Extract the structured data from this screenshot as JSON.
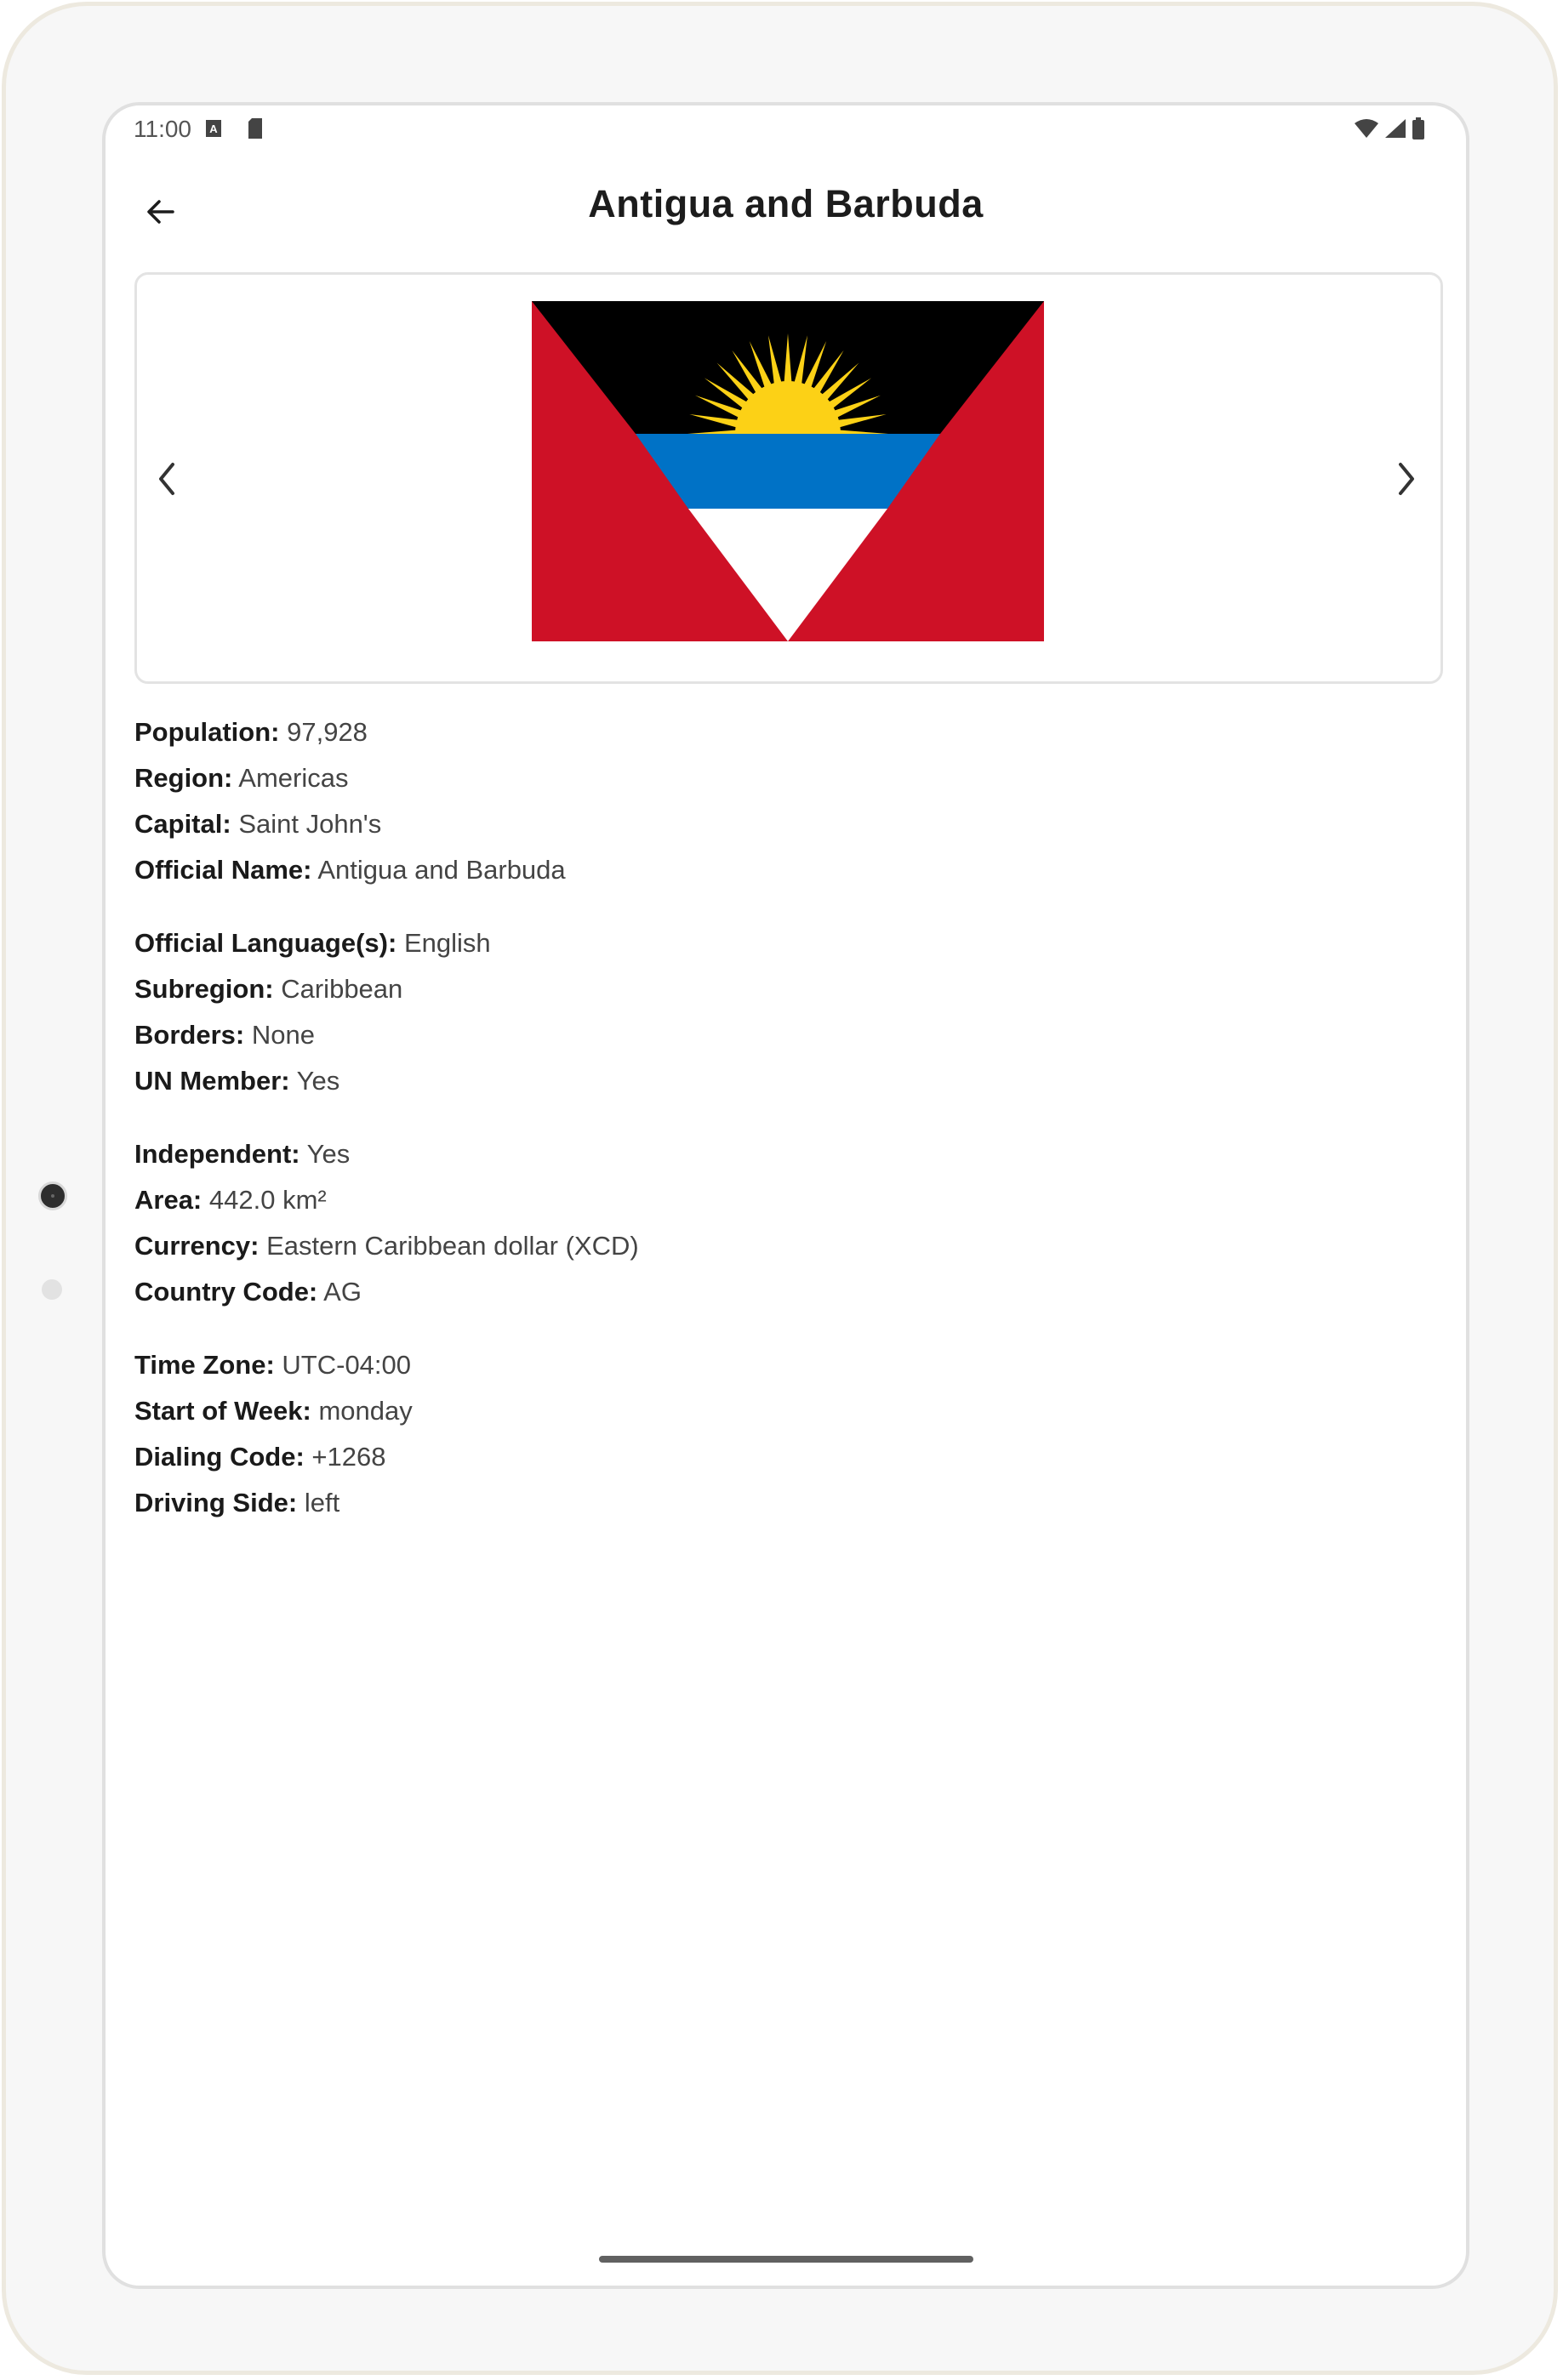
{
  "status_bar": {
    "time": "11:00",
    "keyboard_indicator": "A"
  },
  "app_bar": {
    "title": "Antigua and Barbuda"
  },
  "carousel": {
    "flag_colors": {
      "red": "#ce1126",
      "black": "#000000",
      "blue": "#0072c6",
      "white": "#ffffff",
      "sun": "#fcd116"
    }
  },
  "details": {
    "groups": [
      [
        {
          "label": "Population:",
          "value": "97,928"
        },
        {
          "label": "Region:",
          "value": "Americas"
        },
        {
          "label": "Capital:",
          "value": "Saint John's"
        },
        {
          "label": "Official Name:",
          "value": "Antigua and Barbuda"
        }
      ],
      [
        {
          "label": "Official Language(s):",
          "value": "English"
        },
        {
          "label": "Subregion:",
          "value": "Caribbean"
        },
        {
          "label": "Borders:",
          "value": "None"
        },
        {
          "label": "UN Member:",
          "value": "Yes"
        }
      ],
      [
        {
          "label": "Independent:",
          "value": "Yes"
        },
        {
          "label": "Area:",
          "value": "442.0 km²"
        },
        {
          "label": "Currency:",
          "value": "Eastern Caribbean dollar (XCD)"
        },
        {
          "label": "Country Code:",
          "value": "AG"
        }
      ],
      [
        {
          "label": "Time Zone:",
          "value": "UTC-04:00"
        },
        {
          "label": "Start of Week:",
          "value": "monday"
        },
        {
          "label": "Dialing Code:",
          "value": "+1268"
        },
        {
          "label": "Driving Side:",
          "value": "left"
        }
      ]
    ]
  }
}
